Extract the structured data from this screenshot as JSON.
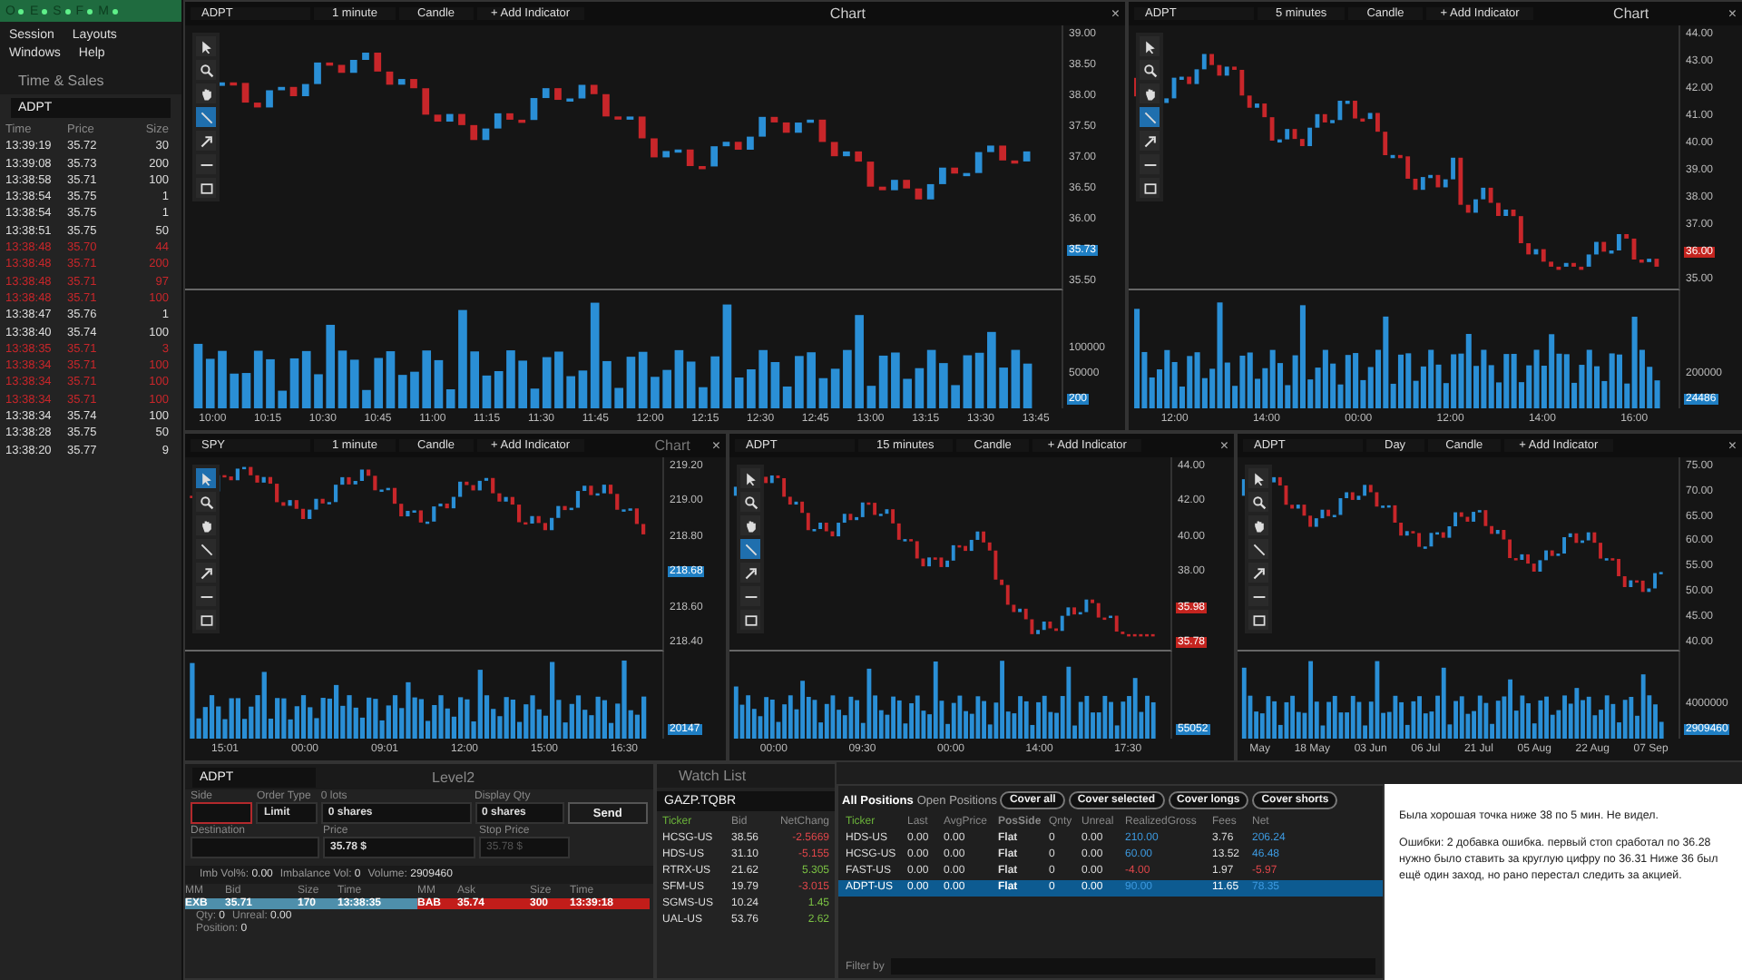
{
  "app_bar": {
    "letters": [
      "O",
      "E",
      "S",
      "F",
      "M"
    ]
  },
  "menu": [
    "Session",
    "Layouts",
    "Windows",
    "Help"
  ],
  "time_sales": {
    "title": "Time & Sales",
    "symbol": "ADPT",
    "columns": [
      "Time",
      "Price",
      "Size"
    ],
    "rows": [
      {
        "time": "13:39:19",
        "price": "35.72",
        "size": "30",
        "at_bid": false
      },
      {
        "time": "13:39:08",
        "price": "35.73",
        "size": "200",
        "at_bid": false
      },
      {
        "time": "13:38:58",
        "price": "35.71",
        "size": "100",
        "at_bid": false
      },
      {
        "time": "13:38:54",
        "price": "35.75",
        "size": "1",
        "at_bid": false
      },
      {
        "time": "13:38:54",
        "price": "35.75",
        "size": "1",
        "at_bid": false
      },
      {
        "time": "13:38:51",
        "price": "35.75",
        "size": "50",
        "at_bid": false
      },
      {
        "time": "13:38:48",
        "price": "35.70",
        "size": "44",
        "at_bid": true
      },
      {
        "time": "13:38:48",
        "price": "35.71",
        "size": "200",
        "at_bid": true
      },
      {
        "time": "13:38:48",
        "price": "35.71",
        "size": "97",
        "at_bid": true
      },
      {
        "time": "13:38:48",
        "price": "35.71",
        "size": "100",
        "at_bid": true
      },
      {
        "time": "13:38:47",
        "price": "35.76",
        "size": "1",
        "at_bid": false
      },
      {
        "time": "13:38:40",
        "price": "35.74",
        "size": "100",
        "at_bid": false
      },
      {
        "time": "13:38:35",
        "price": "35.71",
        "size": "3",
        "at_bid": true
      },
      {
        "time": "13:38:34",
        "price": "35.71",
        "size": "100",
        "at_bid": true
      },
      {
        "time": "13:38:34",
        "price": "35.71",
        "size": "100",
        "at_bid": true
      },
      {
        "time": "13:38:34",
        "price": "35.71",
        "size": "100",
        "at_bid": true
      },
      {
        "time": "13:38:34",
        "price": "35.74",
        "size": "100",
        "at_bid": false
      },
      {
        "time": "13:38:28",
        "price": "35.75",
        "size": "50",
        "at_bid": false
      },
      {
        "time": "13:38:20",
        "price": "35.77",
        "size": "9",
        "at_bid": false
      }
    ]
  },
  "charts": [
    {
      "symbol": "ADPT",
      "interval": "1 minute",
      "chart_type": "Candle",
      "add_indicator": "+ Add Indicator",
      "title": "Chart",
      "close": "×",
      "tools": [
        {
          "kind": "pointer",
          "selected": false
        },
        {
          "kind": "zoom",
          "selected": false
        },
        {
          "kind": "hand",
          "selected": false
        },
        {
          "kind": "line",
          "selected": true
        },
        {
          "kind": "arrow",
          "selected": false
        },
        {
          "kind": "hline",
          "selected": false
        },
        {
          "kind": "rect",
          "selected": false
        }
      ],
      "price_ticks": [
        {
          "label": "39.00"
        },
        {
          "label": "38.50"
        },
        {
          "label": "38.00"
        },
        {
          "label": "37.50"
        },
        {
          "label": "37.00"
        },
        {
          "label": "36.50"
        },
        {
          "label": "36.00"
        },
        {
          "label": "35.73",
          "color": "#1f7fc4"
        },
        {
          "label": "35.50"
        }
      ],
      "volume_ticks": [
        {
          "label": "100000"
        },
        {
          "label": "50000"
        },
        {
          "label": "200",
          "color": "#1f7fc4"
        }
      ],
      "time_ticks": [
        "10:00",
        "10:15",
        "10:30",
        "10:45",
        "11:00",
        "11:15",
        "11:30",
        "11:45",
        "12:00",
        "12:15",
        "12:30",
        "12:45",
        "13:00",
        "13:15",
        "13:30",
        "13:45"
      ]
    },
    {
      "symbol": "ADPT",
      "interval": "5 minutes",
      "chart_type": "Candle",
      "add_indicator": "+ Add Indicator",
      "title": "Chart",
      "close": "×",
      "tools": [
        {
          "kind": "pointer",
          "selected": false
        },
        {
          "kind": "zoom",
          "selected": false
        },
        {
          "kind": "hand",
          "selected": false
        },
        {
          "kind": "line",
          "selected": true
        },
        {
          "kind": "arrow",
          "selected": false
        },
        {
          "kind": "hline",
          "selected": false
        },
        {
          "kind": "rect",
          "selected": false
        }
      ],
      "price_ticks": [
        {
          "label": "44.00"
        },
        {
          "label": "43.00"
        },
        {
          "label": "42.00"
        },
        {
          "label": "41.00"
        },
        {
          "label": "40.00"
        },
        {
          "label": "39.00"
        },
        {
          "label": "38.00"
        },
        {
          "label": "37.00"
        },
        {
          "label": "36.00",
          "color": "#c4241f"
        },
        {
          "label": "35.00"
        }
      ],
      "volume_ticks": [
        {
          "label": "200000"
        },
        {
          "label": "24486",
          "color": "#1f7fc4"
        }
      ],
      "time_ticks": [
        "12:00",
        "14:00",
        "00:00",
        "12:00",
        "14:00",
        "16:00"
      ]
    },
    {
      "symbol": "SPY",
      "interval": "1 minute",
      "chart_type": "Candle",
      "add_indicator": "+ Add Indicator",
      "title": "Chart",
      "close": "×",
      "tools": [
        {
          "kind": "pointer",
          "selected": true
        },
        {
          "kind": "zoom",
          "selected": false
        },
        {
          "kind": "hand",
          "selected": false
        },
        {
          "kind": "line",
          "selected": false
        },
        {
          "kind": "arrow",
          "selected": false
        },
        {
          "kind": "hline",
          "selected": false
        },
        {
          "kind": "rect",
          "selected": false
        }
      ],
      "price_ticks": [
        {
          "label": "219.20"
        },
        {
          "label": "219.00"
        },
        {
          "label": "218.80"
        },
        {
          "label": "218.68",
          "color": "#1f7fc4"
        },
        {
          "label": "218.60"
        },
        {
          "label": "218.40"
        }
      ],
      "volume_ticks": [
        {
          "label": "20147",
          "color": "#1f7fc4"
        }
      ],
      "time_ticks": [
        "15:01",
        "00:00",
        "09:01",
        "12:00",
        "15:00",
        "16:30"
      ]
    },
    {
      "symbol": "ADPT",
      "interval": "15 minutes",
      "chart_type": "Candle",
      "add_indicator": "+ Add Indicator",
      "close": "×",
      "tools": [
        {
          "kind": "pointer",
          "selected": false
        },
        {
          "kind": "zoom",
          "selected": false
        },
        {
          "kind": "hand",
          "selected": false
        },
        {
          "kind": "line",
          "selected": true
        },
        {
          "kind": "arrow",
          "selected": false
        },
        {
          "kind": "hline",
          "selected": false
        },
        {
          "kind": "rect",
          "selected": false
        }
      ],
      "price_ticks": [
        {
          "label": "44.00"
        },
        {
          "label": "42.00"
        },
        {
          "label": "40.00"
        },
        {
          "label": "38.00"
        },
        {
          "label": "35.98",
          "color": "#c4241f"
        },
        {
          "label": "35.78",
          "color": "#c4241f"
        }
      ],
      "volume_ticks": [
        {
          "label": "55052",
          "color": "#1f7fc4"
        }
      ],
      "time_ticks": [
        "00:00",
        "09:30",
        "00:00",
        "14:00",
        "17:30"
      ]
    },
    {
      "symbol": "ADPT",
      "interval": "Day",
      "chart_type": "Candle",
      "add_indicator": "+ Add Indicator",
      "close": "×",
      "tools": [
        {
          "kind": "pointer",
          "selected": false
        },
        {
          "kind": "zoom",
          "selected": false
        },
        {
          "kind": "hand",
          "selected": false
        },
        {
          "kind": "line",
          "selected": false
        },
        {
          "kind": "arrow",
          "selected": false
        },
        {
          "kind": "hline",
          "selected": false
        },
        {
          "kind": "rect",
          "selected": false
        }
      ],
      "price_ticks": [
        {
          "label": "75.00"
        },
        {
          "label": "70.00"
        },
        {
          "label": "65.00"
        },
        {
          "label": "60.00"
        },
        {
          "label": "55.00"
        },
        {
          "label": "50.00"
        },
        {
          "label": "45.00"
        },
        {
          "label": "40.00"
        }
      ],
      "volume_ticks": [
        {
          "label": "4000000"
        },
        {
          "label": "2909460",
          "color": "#1f7fc4"
        }
      ],
      "time_ticks": [
        "May",
        "18 May",
        "03 Jun",
        "06 Jul",
        "21 Jul",
        "05 Aug",
        "22 Aug",
        "07 Sep"
      ]
    }
  ],
  "level2": {
    "symbol": "ADPT",
    "title": "Level2",
    "side_label": "Side",
    "order_type_label": "Order Type",
    "lots_label": "0 lots",
    "display_qty_label": "Display Qty",
    "order_type": "Limit",
    "quantity": "0 shares",
    "display_qty": "0 shares",
    "send": "Send",
    "destination_label": "Destination",
    "price_label": "Price",
    "price": "35.78 $",
    "stop_price_label": "Stop Price",
    "stop_price": "35.78 $",
    "info": [
      {
        "label": "Imb Vol%:",
        "value": "0.00"
      },
      {
        "label": "Imbalance Vol:",
        "value": "0"
      },
      {
        "label": "Volume:",
        "value": "2909460"
      }
    ],
    "bid_columns": [
      "MM",
      "Bid",
      "Size",
      "Time"
    ],
    "ask_columns": [
      "MM",
      "Ask",
      "Size",
      "Time"
    ],
    "bid": [
      "EXB",
      "35.71",
      "170",
      "13:38:35"
    ],
    "ask": [
      "BAB",
      "35.74",
      "300",
      "13:39:18"
    ],
    "footer": [
      {
        "label": "Qty:",
        "value": "0"
      },
      {
        "label": "Unreal:",
        "value": "0.00"
      },
      {
        "label": "Position:",
        "value": "0"
      }
    ]
  },
  "watch_list": {
    "title": "Watch List",
    "list_name": "GAZP.TQBR",
    "columns": [
      "Ticker",
      "Bid",
      "NetChang"
    ],
    "rows": [
      {
        "ticker": "HCSG-US",
        "bid": "38.56",
        "change": "-2.5669",
        "negative": true
      },
      {
        "ticker": "HDS-US",
        "bid": "31.10",
        "change": "-5.155",
        "negative": true
      },
      {
        "ticker": "RTRX-US",
        "bid": "21.62",
        "change": "5.305",
        "negative": false
      },
      {
        "ticker": "SFM-US",
        "bid": "19.79",
        "change": "-3.015",
        "negative": true
      },
      {
        "ticker": "SGMS-US",
        "bid": "10.24",
        "change": "1.45",
        "negative": false
      },
      {
        "ticker": "UAL-US",
        "bid": "53.76",
        "change": "2.62",
        "negative": false
      }
    ]
  },
  "positions": {
    "tabs": [
      {
        "label": "All Positions",
        "selected": true
      },
      {
        "label": "Open Positions",
        "selected": false
      }
    ],
    "buttons": [
      "Cover all",
      "Cover selected",
      "Cover longs",
      "Cover shorts"
    ],
    "columns": [
      "Ticker",
      "Last",
      "AvgPrice",
      "PosSide",
      "Qnty",
      "Unreal",
      "RealizedGross",
      "Fees",
      "Net"
    ],
    "rows": [
      {
        "cells": [
          "HDS-US",
          "0.00",
          "0.00",
          "Flat",
          "0",
          "0.00",
          "210.00",
          "3.76",
          "206.24"
        ],
        "negative": false,
        "selected": false
      },
      {
        "cells": [
          "HCSG-US",
          "0.00",
          "0.00",
          "Flat",
          "0",
          "0.00",
          "60.00",
          "13.52",
          "46.48"
        ],
        "negative": false,
        "selected": false
      },
      {
        "cells": [
          "FAST-US",
          "0.00",
          "0.00",
          "Flat",
          "0",
          "0.00",
          "-4.00",
          "1.97",
          "-5.97"
        ],
        "negative": true,
        "selected": false
      },
      {
        "cells": [
          "ADPT-US",
          "0.00",
          "0.00",
          "Flat",
          "0",
          "0.00",
          "90.00",
          "11.65",
          "78.35"
        ],
        "negative": false,
        "selected": true
      }
    ],
    "filter_label": "Filter by"
  },
  "notes": [
    "Была хорошая точка ниже 38 по 5 мин. Не видел.",
    "Ошибки: 2 добавка ошибка. первый стоп сработал по 36.28 нужно было ставить за круглую цифру по 36.31  Ниже 36 был ещё один заход, но рано перестал следить за акцией."
  ]
}
